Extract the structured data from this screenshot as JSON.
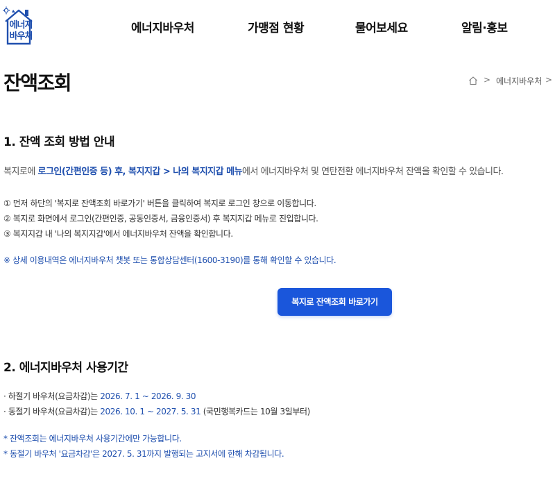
{
  "header": {
    "logo_text": "에너지\n바우처",
    "logo_line1": "에너지",
    "logo_line2": "바우처",
    "nav": [
      "에너지바우처",
      "가맹점 현황",
      "물어보세요",
      "알림·홍보"
    ]
  },
  "page": {
    "title": "잔액조회",
    "breadcrumb": {
      "home_icon": "home-icon",
      "separator": ">",
      "current": "에너지바우처",
      "trailing": ">"
    }
  },
  "section1": {
    "title": "1. 잔액 조회 방법 안내",
    "intro_pre": "복지로에 ",
    "intro_highlight": "로그인(간편인증 등) 후, 복지지갑 > 나의 복지지갑 메뉴",
    "intro_post": "에서 에너지바우처 및 연탄전환 에너지바우처 잔액을 확인할 수 있습니다.",
    "steps": [
      "① 먼저 하단의 '복지로 잔액조회 바로가기' 버튼을 클릭하여 복지로 로그인 창으로 이동합니다.",
      "② 복지로 화면에서 로그인(간편인증, 공동인증서, 금융인증서) 후 복지지갑 메뉴로 진입합니다.",
      "③ 복지지갑 내 '나의 복지지갑'에서 에너지바우처 잔액을 확인합니다."
    ],
    "note": "※ 상세 이용내역은 에너지바우처 챗봇 또는 통합상담센터(1600-3190)를 통해 확인할 수 있습니다.",
    "button_label": "복지로 잔액조회 바로가기"
  },
  "section2": {
    "title": "2. 에너지바우처 사용기간",
    "periods": [
      {
        "label": "· 하절기 바우처(요금차감)는 ",
        "range": "2026. 7. 1 ~ 2026. 9. 30",
        "extra": ""
      },
      {
        "label": "· 동절기 바우처(요금차감)는 ",
        "range": "2026. 10. 1 ~ 2027. 5. 31",
        "extra": " (국민행복카드는 10월 3일부터)"
      }
    ],
    "notes": [
      "* 잔액조회는 에너지바우처 사용기간에만 가능합니다.",
      "* 동절기 바우처 '요금차감'은 2027. 5. 31까지 발행되는 고지서에 한해 차감됩니다."
    ]
  },
  "colors": {
    "accent": "#1a56db",
    "highlight_text": "#1f4fae",
    "body_text": "#333333"
  }
}
